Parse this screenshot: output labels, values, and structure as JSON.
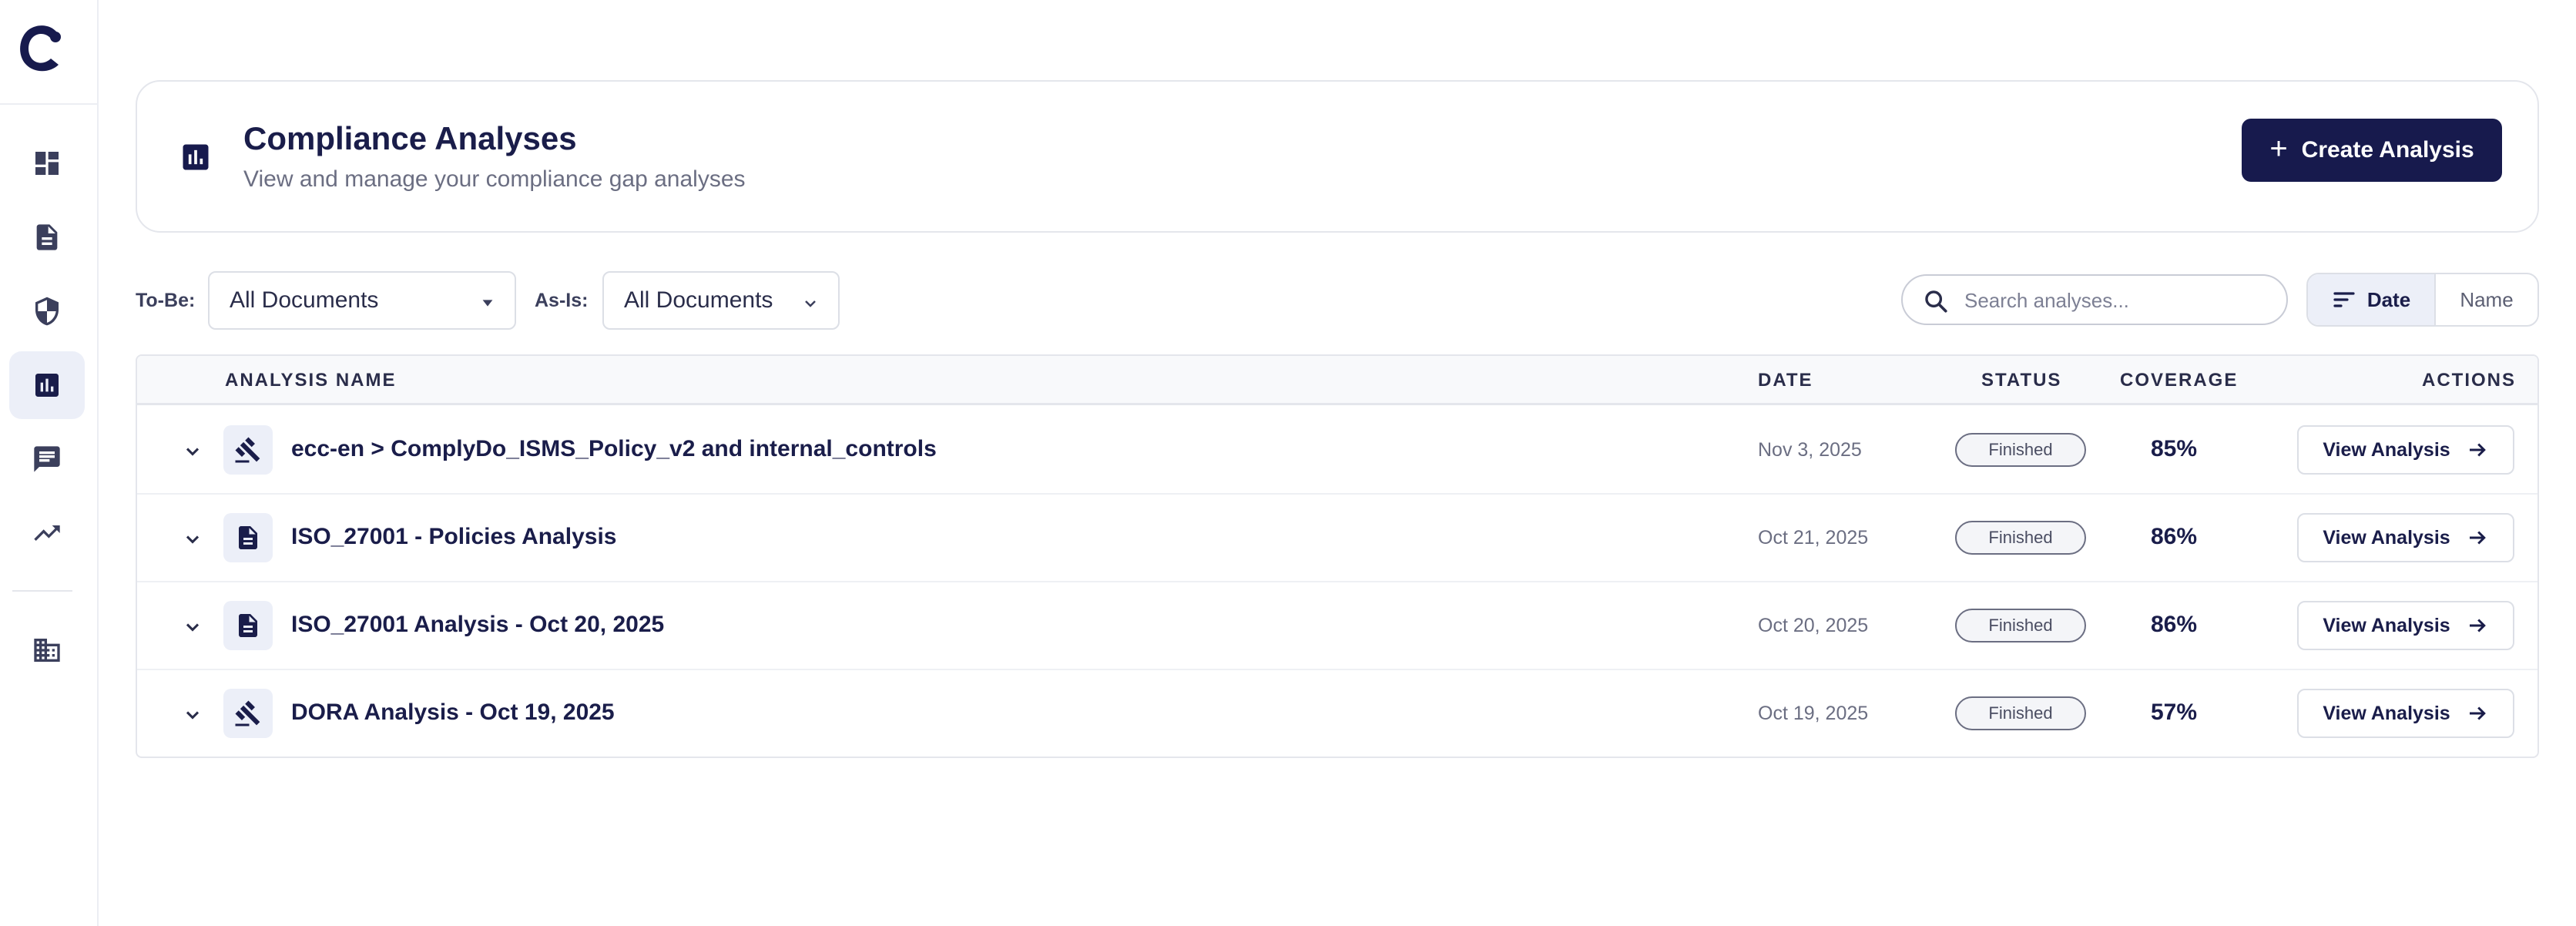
{
  "sidebar": {
    "logo": "C-logo-icon",
    "items": [
      {
        "icon": "dashboard-icon"
      },
      {
        "icon": "document-icon"
      },
      {
        "icon": "shield-icon"
      },
      {
        "icon": "bar-chart-icon",
        "active": true
      },
      {
        "icon": "chat-icon"
      },
      {
        "icon": "trending-up-icon"
      },
      {
        "icon": "building-icon"
      }
    ]
  },
  "header": {
    "title": "Compliance Analyses",
    "subtitle": "View and manage your compliance gap analyses",
    "create_label": "Create Analysis",
    "create_icon": "+"
  },
  "filters": {
    "to_be_label": "To-Be:",
    "to_be_value": "All Documents",
    "as_is_label": "As-Is:",
    "as_is_value": "All Documents",
    "search_placeholder": "Search analyses...",
    "sort_date": "Date",
    "sort_name": "Name"
  },
  "table": {
    "headers": {
      "name": "ANALYSIS NAME",
      "date": "DATE",
      "status": "STATUS",
      "coverage": "COVERAGE",
      "actions": "ACTIONS"
    },
    "rows": [
      {
        "icon": "gavel-icon",
        "name": "ecc-en > ComplyDo_ISMS_Policy_v2 and internal_controls",
        "date": "Nov 3, 2025",
        "status": "Finished",
        "coverage": "85%",
        "action": "View Analysis"
      },
      {
        "icon": "document-icon",
        "name": "ISO_27001 - Policies Analysis",
        "date": "Oct 21, 2025",
        "status": "Finished",
        "coverage": "86%",
        "action": "View Analysis"
      },
      {
        "icon": "document-icon",
        "name": "ISO_27001 Analysis - Oct 20, 2025",
        "date": "Oct 20, 2025",
        "status": "Finished",
        "coverage": "86%",
        "action": "View Analysis"
      },
      {
        "icon": "gavel-icon",
        "name": "DORA Analysis - Oct 19, 2025",
        "date": "Oct 19, 2025",
        "status": "Finished",
        "coverage": "57%",
        "action": "View Analysis"
      }
    ]
  },
  "colors": {
    "primary": "#171a4d",
    "active_bg": "#eceff8",
    "border": "#e4e6ec",
    "muted_text": "#6b6e82"
  }
}
